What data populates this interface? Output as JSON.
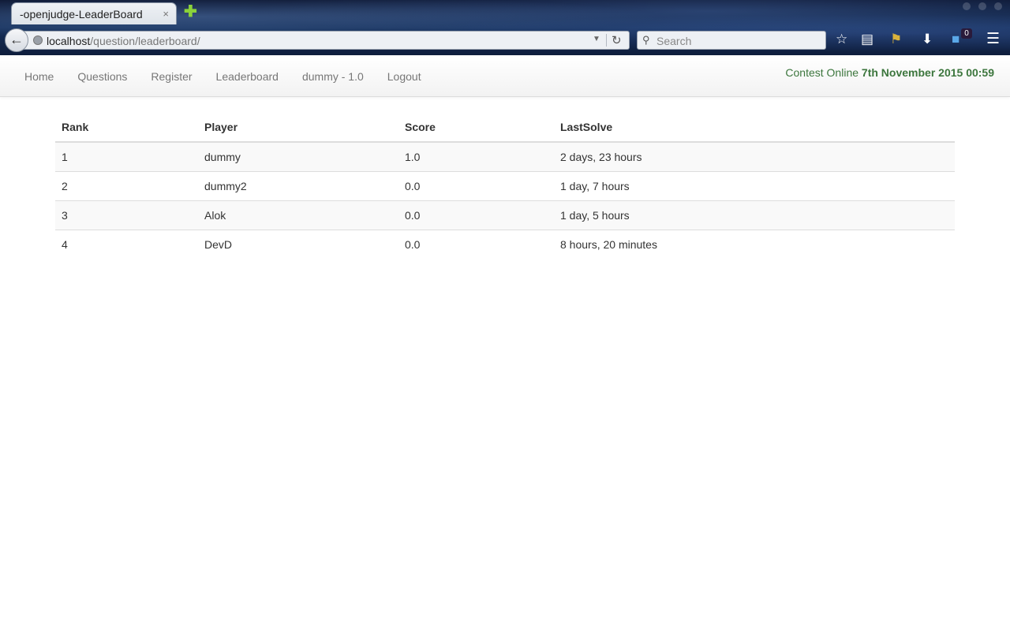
{
  "browser": {
    "tab_title": "-openjudge-LeaderBoard",
    "tab_close": "×",
    "new_tab": "✚",
    "url_host": "localhost",
    "url_path": "/question/leaderboard/",
    "search_placeholder": "Search",
    "badge_count": "0"
  },
  "navbar": {
    "links": [
      "Home",
      "Questions",
      "Register",
      "Leaderboard",
      "dummy - 1.0",
      "Logout"
    ],
    "status_prefix": "Contest Online ",
    "status_time": "7th November 2015 00:59"
  },
  "leaderboard": {
    "columns": [
      "Rank",
      "Player",
      "Score",
      "LastSolve"
    ],
    "rows": [
      {
        "rank": "1",
        "player": "dummy",
        "score": "1.0",
        "last_solve": "2 days, 23 hours"
      },
      {
        "rank": "2",
        "player": "dummy2",
        "score": "0.0",
        "last_solve": "1 day, 7 hours"
      },
      {
        "rank": "3",
        "player": "Alok",
        "score": "0.0",
        "last_solve": "1 day, 5 hours"
      },
      {
        "rank": "4",
        "player": "DevD",
        "score": "0.0",
        "last_solve": "8 hours, 20 minutes"
      }
    ]
  }
}
